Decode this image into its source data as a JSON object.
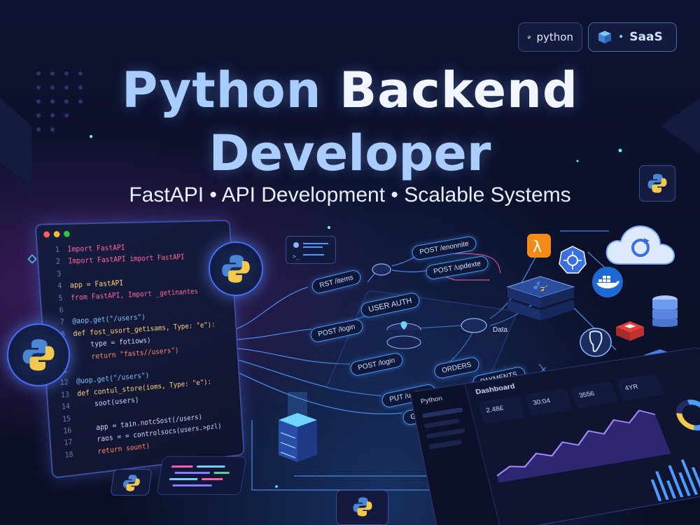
{
  "badges": {
    "python": "python",
    "saas": "SaaS"
  },
  "title": {
    "part1": "Python",
    "part2": "Backend",
    "line2": "Developer"
  },
  "subtitle": "FastAPI • API Development • Scalable Systems",
  "code": {
    "lines": [
      {
        "n": "1",
        "t": "Import FastAPI"
      },
      {
        "n": "2",
        "t": "Import FastAPI import FastAPI"
      },
      {
        "n": "3",
        "t": ""
      },
      {
        "n": "4",
        "t": "app = FastAPI"
      },
      {
        "n": "5",
        "t": "from FastAPI, Import _getinantes"
      },
      {
        "n": "6",
        "t": ""
      },
      {
        "n": "7",
        "t": "@aop.get(\"/users\")"
      },
      {
        "n": "8",
        "t": "def fost_usort_getisams, Type: \"e\"):"
      },
      {
        "n": "9",
        "t": "    type = fotiows)"
      },
      {
        "n": "10",
        "t": "    return \"fasts//users\")"
      },
      {
        "n": "11",
        "t": ""
      },
      {
        "n": "12",
        "t": "@uop.get(\"/users\")"
      },
      {
        "n": "13",
        "t": "def contul_store(ioms, Type: \"e\"):"
      },
      {
        "n": "14",
        "t": "    soot(users)"
      },
      {
        "n": "15",
        "t": ""
      },
      {
        "n": "16",
        "t": "    app = tain.notcSost(/users)"
      },
      {
        "n": "17",
        "t": "    raos = = controlsocs(users.>pzl)"
      },
      {
        "n": "18",
        "t": "    return sount)"
      }
    ]
  },
  "nodes": {
    "get_items": "RST /items",
    "post_enonnite": "POST /enonnite",
    "post_updexte": "POST /updexte",
    "user_auth": "USER AUTH",
    "post_login_1": "POST /login",
    "post_login_2": "POST /login",
    "orders": "ORDERS",
    "payments": "PAYMENTS",
    "put_update": "PUT /update",
    "get_update": "GET /update",
    "data": "Data"
  },
  "dashboard": {
    "brand": "Python",
    "title": "Dashboard",
    "stats": [
      "2.48£",
      "30:04",
      "3556",
      "4YR"
    ]
  },
  "colors": {
    "accent": "#4d9bff",
    "title": "#bcd9ff",
    "background": "#0b0f26"
  }
}
